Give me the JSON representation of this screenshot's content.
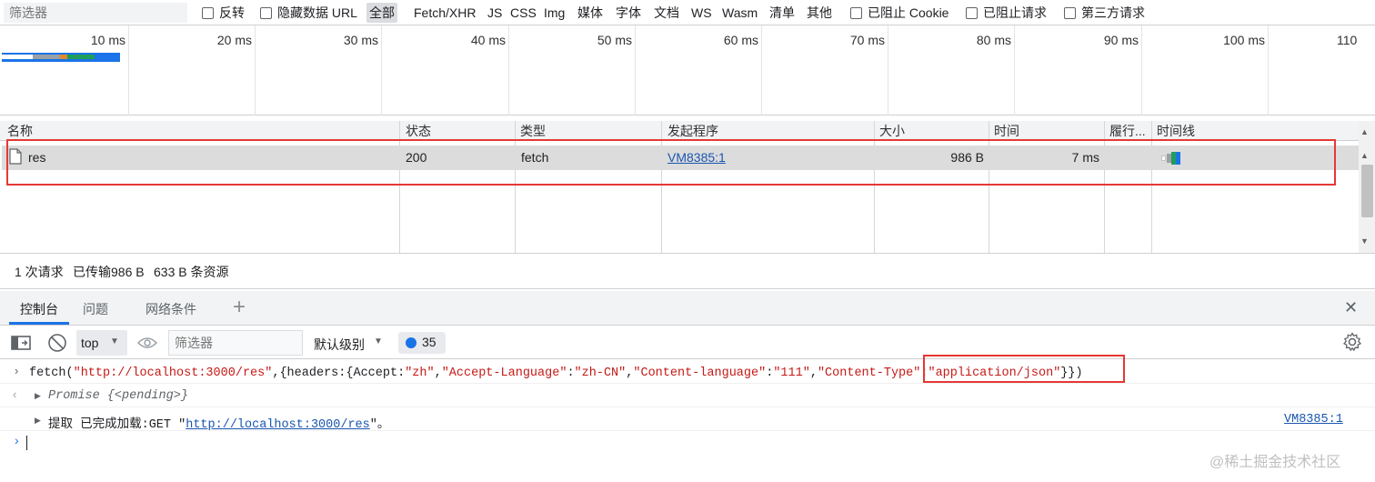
{
  "filter_bar": {
    "placeholder": "筛选器",
    "invert_label": "反转",
    "hide_data_url_label": "隐藏数据 URL",
    "types": [
      "全部",
      "Fetch/XHR",
      "JS",
      "CSS",
      "Img",
      "媒体",
      "字体",
      "文档",
      "WS",
      "Wasm",
      "清单",
      "其他"
    ],
    "active_type": "全部",
    "blocked_cookies_label": "已阻止 Cookie",
    "blocked_requests_label": "已阻止请求",
    "third_party_label": "第三方请求"
  },
  "overview": {
    "ticks": [
      "10 ms",
      "20 ms",
      "30 ms",
      "40 ms",
      "50 ms",
      "60 ms",
      "70 ms",
      "80 ms",
      "90 ms",
      "100 ms",
      "110"
    ]
  },
  "table": {
    "headers": [
      "名称",
      "状态",
      "类型",
      "发起程序",
      "大小",
      "时间",
      "履行...",
      "时间线"
    ],
    "rows": [
      {
        "name": "res",
        "status": "200",
        "type": "fetch",
        "initiator": "VM8385:1",
        "size": "986 B",
        "time": "7 ms"
      }
    ]
  },
  "status": {
    "requests": "1 次请求",
    "transferred": "已传输986 B",
    "resources": "633 B 条资源"
  },
  "drawer_tabs": {
    "items": [
      "控制台",
      "问题",
      "网络条件"
    ],
    "active": "控制台",
    "add": "+",
    "close": "✕"
  },
  "console_toolbar": {
    "context": "top",
    "filter_placeholder": "筛选器",
    "level": "默认级别",
    "issues_count": "35"
  },
  "console": {
    "input_prefix": "fetch(",
    "url": "\"http://localhost:3000/res\"",
    "mid": ",{headers:{Accept:",
    "accept_val": "\"zh\"",
    "comma1": ",",
    "accept_lang_key": "\"Accept-Language\"",
    "colon": ":",
    "accept_lang_val": "\"zh-CN\"",
    "comma2": ",",
    "content_lang_key": "\"Content-language\"",
    "colon2": ":",
    "content_lang_val": "\"111\"",
    "comma3": ",",
    "content_type_key": "\"Content-Type\"",
    "colon3": ":",
    "content_type_val": "\"application/json\"",
    "suffix": "}})",
    "promise_label": "Promise",
    "promise_state": "{<pending>}",
    "log_prefix": "提取 已完成加载:GET \"",
    "log_url": "http://localhost:3000/res",
    "log_suffix": "\"。",
    "log_source": "VM8385:1"
  },
  "watermark": "@稀土掘金技术社区",
  "colors": {
    "accent": "#1a73e8",
    "highlight_box": "#e53935",
    "link": "#1a56b0",
    "string": "#c41a16"
  }
}
